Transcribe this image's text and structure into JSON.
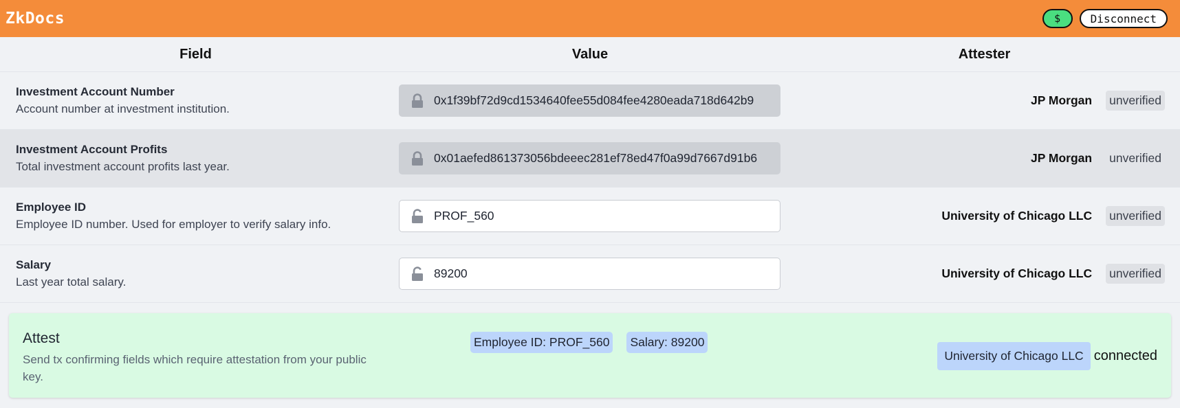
{
  "app": {
    "title": "ZkDocs",
    "wallet_button_label": "$",
    "disconnect_label": "Disconnect"
  },
  "table": {
    "headers": {
      "field": "Field",
      "value": "Value",
      "attester": "Attester"
    },
    "rows": [
      {
        "name": "Investment Account Number",
        "description": "Account number at investment institution.",
        "value": "0x1f39bf72d9cd1534640fee55d084fee4280eada718d642b9",
        "locked": true,
        "attester": "JP Morgan",
        "status": "unverified"
      },
      {
        "name": "Investment Account Profits",
        "description": "Total investment account profits last year.",
        "value": "0x01aefed861373056bdeeec281ef78ed47f0a99d7667d91b6",
        "locked": true,
        "attester": "JP Morgan",
        "status": "unverified"
      },
      {
        "name": "Employee ID",
        "description": "Employee ID number. Used for employer to verify salary info.",
        "value": "PROF_560",
        "locked": false,
        "attester": "University of Chicago LLC",
        "status": "unverified"
      },
      {
        "name": "Salary",
        "description": "Last year total salary.",
        "value": "89200",
        "locked": false,
        "attester": "University of Chicago LLC",
        "status": "unverified"
      }
    ]
  },
  "attest": {
    "title": "Attest",
    "description": "Send tx confirming fields which require attestation from your public key.",
    "chips": [
      "Employee ID: PROF_560",
      "Salary: 89200"
    ],
    "attester": "University of Chicago LLC",
    "connection_status": "connected"
  },
  "colors": {
    "header_bg": "#f48c3a",
    "wallet_button": "#4ade80",
    "attest_bg": "#d9fae3",
    "chip_bg": "#bcd5fb"
  },
  "icons": {
    "locked": "lock-closed-icon",
    "unlocked": "lock-open-icon"
  }
}
